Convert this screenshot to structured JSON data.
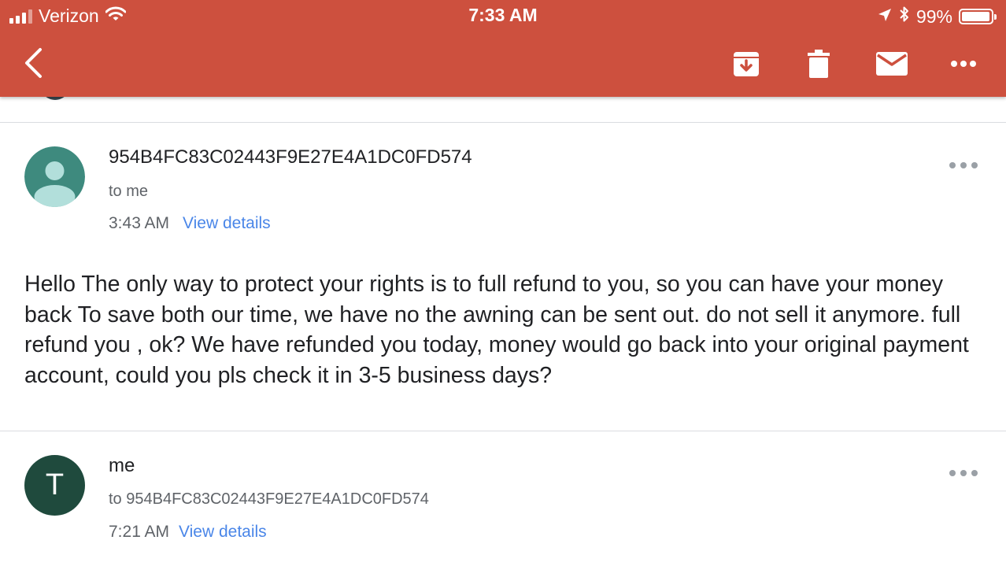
{
  "status_bar": {
    "carrier": "Verizon",
    "time": "7:33 AM",
    "battery": "99%",
    "battery_level": 0.99
  },
  "toolbar": {
    "icons": [
      "back-arrow-icon",
      "archive-icon",
      "trash-icon",
      "mail-icon",
      "more-icon"
    ]
  },
  "messages": [
    {
      "sender": "954B4FC83C02443F9E27E4A1DC0FD574",
      "recipient": "to me",
      "time": "3:43 AM",
      "details_link": "View details",
      "body": "Hello The only way to protect your rights is to full refund to you, so you can have your money back To save both our time, we have no the awning can be sent out. do not sell it anymore. full refund you , ok? We have refunded you today, money would go back into your original payment account, could you pls check it in 3-5 business days?",
      "avatar_color": "#3e8a7e"
    },
    {
      "sender": "me",
      "recipient": "to 954B4FC83C02443F9E27E4A1DC0FD574",
      "time": "7:21 AM",
      "details_link": "View details",
      "avatar_letter": "T",
      "avatar_color": "#1f4a3d"
    }
  ],
  "colors": {
    "header": "#cd503e",
    "link": "#4a86e8"
  }
}
